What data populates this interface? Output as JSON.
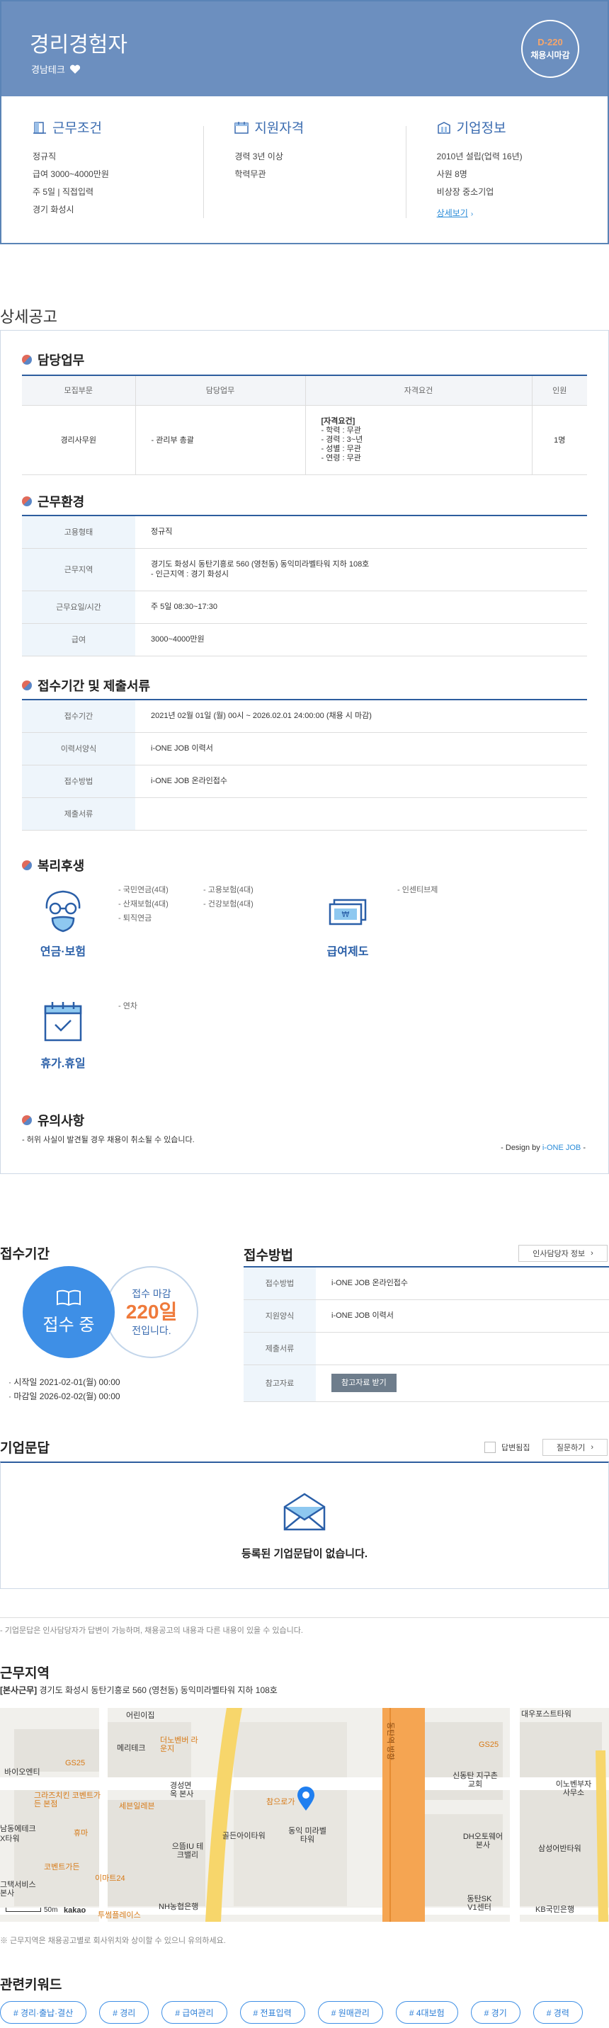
{
  "header": {
    "title": "경리경험자",
    "company": "경남테크",
    "dday": "D-220",
    "dday_label": "채용시마감"
  },
  "summary": {
    "work": {
      "title": "근무조건",
      "lines": [
        "정규직",
        "급여 3000~4000만원",
        "주 5일 | 직접입력",
        "경기 화성시"
      ]
    },
    "qualify": {
      "title": "지원자격",
      "lines": [
        "경력 3년 이상",
        "학력무관"
      ]
    },
    "company": {
      "title": "기업정보",
      "lines": [
        "2010년 설립(업력 16년)",
        "사원 8명",
        "비상장 중소기업"
      ],
      "more": "상세보기"
    }
  },
  "detail": {
    "title": "상세공고",
    "duty": {
      "title": "담당업무",
      "headers": [
        "모집부문",
        "담당업무",
        "자격요건",
        "인원"
      ],
      "row": {
        "dept": "경리사무원",
        "task": "- 관리부 총괄",
        "qual_title": "[자격요건]",
        "qual_lines": [
          "- 학력 : 무관",
          "- 경력 : 3~년",
          "- 성별 : 무관",
          "- 연령 : 무관"
        ],
        "count": "1명"
      }
    },
    "env": {
      "title": "근무환경",
      "rows": [
        {
          "k": "고용형태",
          "v": "정규직",
          "v2": ""
        },
        {
          "k": "근무지역",
          "v": "경기도 화성시 동탄기흥로 560 (영천동) 동익미라벨타워 지하 108호",
          "v2": "- 인근지역 : 경기 화성시"
        },
        {
          "k": "근무요일/시간",
          "v": "주 5일 08:30~17:30",
          "v2": ""
        },
        {
          "k": "급여",
          "v": "3000~4000만원",
          "v2": ""
        }
      ]
    },
    "receipt": {
      "title": "접수기간 및 제출서류",
      "rows": [
        {
          "k": "접수기간",
          "v": "2021년 02월 01일 (월) 00시 ~ 2026.02.01 24:00:00 (채용 시 마감)"
        },
        {
          "k": "이력서양식",
          "v": "i-ONE JOB 이력서"
        },
        {
          "k": "접수방법",
          "v": "i-ONE JOB 온라인접수"
        },
        {
          "k": "제출서류",
          "v": ""
        }
      ]
    },
    "welfare": {
      "title": "복리후생",
      "pension": {
        "name": "연금·보험",
        "col1": [
          "- 국민연금(4대)",
          "- 산재보험(4대)",
          "- 퇴직연금"
        ],
        "col2": [
          "- 고용보험(4대)",
          "- 건강보험(4대)"
        ]
      },
      "salary": {
        "name": "급여제도",
        "col1": [
          "- 인센티브제"
        ]
      },
      "holiday": {
        "name": "휴가.휴일",
        "col1": [
          "- 연차"
        ]
      }
    },
    "notice": {
      "title": "유의사항",
      "text": "- 허위 사실이 발견될 경우 채용이 취소될 수 있습니다.",
      "design_prefix": "- Design by ",
      "design_brand": "i-ONE JOB",
      "design_suffix": " -"
    }
  },
  "apply": {
    "period_title": "접수기간",
    "status": "접수 중",
    "deadline_label": "접수 마감",
    "deadline_days": "220일",
    "deadline_suffix": "전입니다.",
    "start": "시작일 2021-02-01(월) 00:00",
    "end": "마감일 2026-02-02(월) 00:00",
    "method_title": "접수방법",
    "contact_button": "인사담당자 정보",
    "rows": [
      {
        "k": "접수방법",
        "v": "i-ONE JOB 온라인접수"
      },
      {
        "k": "지원양식",
        "v": "i-ONE JOB 이력서"
      },
      {
        "k": "제출서류",
        "v": ""
      },
      {
        "k": "참고자료",
        "v": ""
      }
    ],
    "download_button": "참고자료 받기"
  },
  "qa": {
    "title": "기업문답",
    "answered_label": "답변됨집",
    "ask_button": "질문하기",
    "empty": "등록된 기업문답이 없습니다.",
    "note": "- 기업문답은 인사담당자가 답변이 가능하며, 채용공고의 내용과 다른 내용이 있을 수 있습니다."
  },
  "location": {
    "title": "근무지역",
    "tag": "[본사근무]",
    "address": "경기도 화성시 동탄기흥로 560 (영천동) 동익미라벨타워 지하 108호",
    "map_labels": {
      "l1": "어린이집",
      "l2": "메리테크",
      "l3": "GS25",
      "l4": "더노벤버 라운지",
      "l5": "바이오엔티",
      "l6": "그라즈치킨 코벤트가든 본점",
      "l7": "세븐일레븐",
      "l8": "경성면옥 본사",
      "l9": "참으로가",
      "l10": "동탄역 방향",
      "l11": "GS25",
      "l12": "신동탄 지구촌교회",
      "l13": "이노벤부자 사무소",
      "l14": "골든아이타워",
      "l15": "동익 미라벨타워",
      "l16": "으뜸IU 테크밸리",
      "l17": "DH오토웨어 본사",
      "l18": "삼성어반타워",
      "l19": "코벤트가든",
      "l20": "이마트24",
      "l21": "투썸플레이스",
      "l22": "NH농협은행",
      "l23": "동탄SK V1센터",
      "l24": "KB국민은행",
      "l25": "휴마",
      "l26": "남동에테크",
      "l27": "그택서비스 본사",
      "l28": "X타워",
      "l29": "대우포스트타워",
      "scale": "50m",
      "logo": "kakao"
    },
    "note": "※ 근무지역은 채용공고별로 회사위치와 상이할 수 있으니 유의하세요."
  },
  "keywords": {
    "title": "관련키워드",
    "items": [
      "# 경리·출납·결산",
      "# 경리",
      "# 급여관리",
      "# 전표입력",
      "# 원매관리",
      "# 4대보험",
      "# 경기",
      "# 경력"
    ]
  },
  "colors": {
    "brand": "#6c8fbf",
    "accent": "#3e8fe6",
    "orange": "#ef7a3b",
    "line": "#2d5d9e"
  }
}
